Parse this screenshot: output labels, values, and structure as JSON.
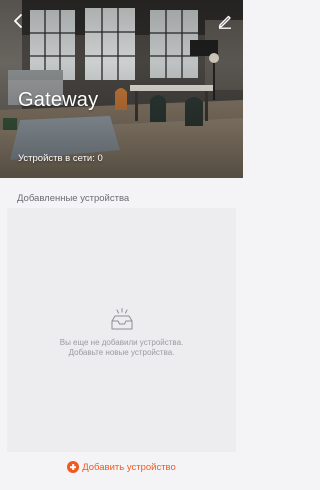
{
  "header": {
    "title": "Gateway",
    "status": "Устройств в сети: 0",
    "back_icon": "chevron-left-icon",
    "edit_icon": "pencil-icon"
  },
  "devices_section": {
    "title": "Добавленные устройства",
    "empty_icon": "empty-tray-icon",
    "empty_line1": "Вы еще не добавили устройства.",
    "empty_line2": "Добавьте новые устройства."
  },
  "footer": {
    "add_label": "Добавить устройство",
    "add_icon": "plus-circle-icon"
  },
  "colors": {
    "accent": "#f05a1e",
    "background": "#f4f4f6",
    "panel": "#ededf0",
    "muted_text": "#9a9aa0"
  }
}
